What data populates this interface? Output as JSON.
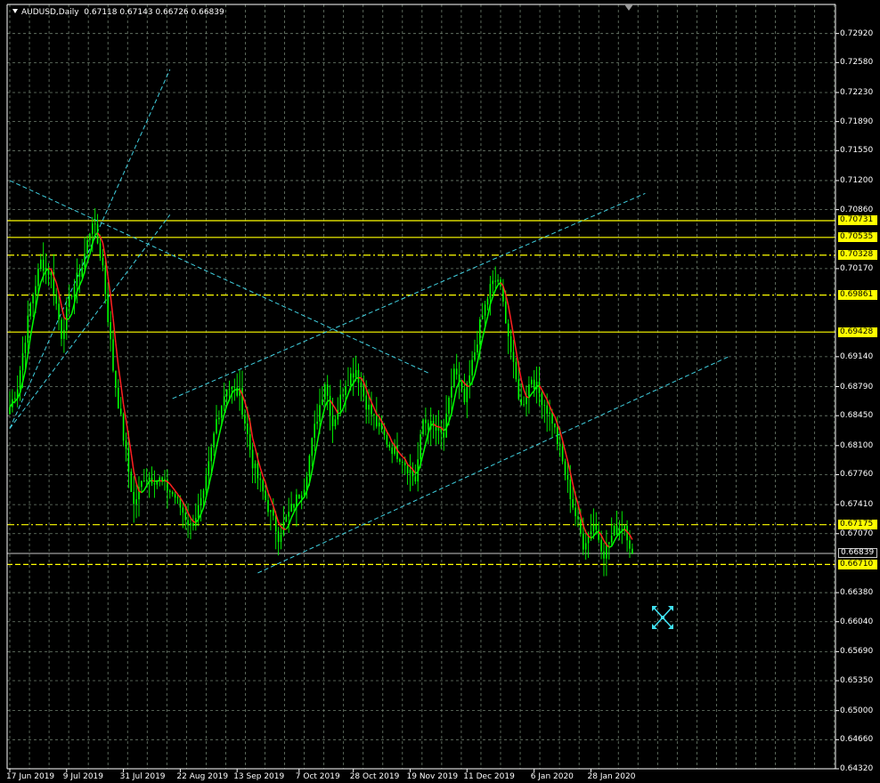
{
  "title": {
    "symbol_period": "AUDUSD,Daily",
    "ohlc": "0.67118 0.67143 0.66726 0.66839"
  },
  "colors": {
    "background": "#000000",
    "grid": "#6f7f6f",
    "bull": "#00ff00",
    "ma": "#ff2020",
    "trend": "#40d0e0",
    "level": "#ffff00",
    "price_line": "#c8c8c8",
    "text": "#ffffff"
  },
  "icons": {
    "shift_marker": "triangle-down-icon",
    "cursor": "move-cursor-icon"
  },
  "chart_data": {
    "type": "candlestick",
    "symbol": "AUDUSD",
    "timeframe": "Daily",
    "x_ticks": [
      {
        "label": "17 Jun 2019",
        "day": 0
      },
      {
        "label": "9 Jul 2019",
        "day": 22
      },
      {
        "label": "31 Jul 2019",
        "day": 44
      },
      {
        "label": "22 Aug 2019",
        "day": 66
      },
      {
        "label": "13 Sep 2019",
        "day": 88
      },
      {
        "label": "7 Oct 2019",
        "day": 112
      },
      {
        "label": "28 Oct 2019",
        "day": 133
      },
      {
        "label": "19 Nov 2019",
        "day": 155
      },
      {
        "label": "11 Dec 2019",
        "day": 177
      },
      {
        "label": "6 Jan 2020",
        "day": 203
      },
      {
        "label": "28 Jan 2020",
        "day": 225
      }
    ],
    "x_range": [
      0,
      250
    ],
    "y_ticks": [
      "0.72920",
      "0.72580",
      "0.72230",
      "0.71890",
      "0.71550",
      "0.71200",
      "0.70860",
      "0.70170",
      "0.69140",
      "0.68790",
      "0.68450",
      "0.68100",
      "0.67760",
      "0.67410",
      "0.67070",
      "0.66380",
      "0.66040",
      "0.65690",
      "0.65350",
      "0.65000",
      "0.64660",
      "0.64320"
    ],
    "ylim": [
      0.6432,
      0.7326
    ],
    "grid": true,
    "anchors": [
      {
        "day": 0,
        "price": 0.6855
      },
      {
        "day": 3,
        "price": 0.688
      },
      {
        "day": 8,
        "price": 0.6975
      },
      {
        "day": 12,
        "price": 0.7025
      },
      {
        "day": 16,
        "price": 0.701
      },
      {
        "day": 20,
        "price": 0.694
      },
      {
        "day": 24,
        "price": 0.699
      },
      {
        "day": 28,
        "price": 0.702
      },
      {
        "day": 32,
        "price": 0.7075
      },
      {
        "day": 36,
        "price": 0.702
      },
      {
        "day": 40,
        "price": 0.69
      },
      {
        "day": 44,
        "price": 0.682
      },
      {
        "day": 48,
        "price": 0.674
      },
      {
        "day": 52,
        "price": 0.6775
      },
      {
        "day": 58,
        "price": 0.677
      },
      {
        "day": 64,
        "price": 0.675
      },
      {
        "day": 70,
        "price": 0.6715
      },
      {
        "day": 75,
        "price": 0.675
      },
      {
        "day": 80,
        "price": 0.684
      },
      {
        "day": 84,
        "price": 0.688
      },
      {
        "day": 89,
        "price": 0.687
      },
      {
        "day": 94,
        "price": 0.679
      },
      {
        "day": 98,
        "price": 0.6755
      },
      {
        "day": 104,
        "price": 0.6705
      },
      {
        "day": 108,
        "price": 0.673
      },
      {
        "day": 114,
        "price": 0.6765
      },
      {
        "day": 118,
        "price": 0.683
      },
      {
        "day": 122,
        "price": 0.6885
      },
      {
        "day": 125,
        "price": 0.6835
      },
      {
        "day": 130,
        "price": 0.6885
      },
      {
        "day": 134,
        "price": 0.69
      },
      {
        "day": 138,
        "price": 0.686
      },
      {
        "day": 142,
        "price": 0.6835
      },
      {
        "day": 147,
        "price": 0.681
      },
      {
        "day": 152,
        "price": 0.6795
      },
      {
        "day": 157,
        "price": 0.677
      },
      {
        "day": 160,
        "price": 0.684
      },
      {
        "day": 164,
        "price": 0.683
      },
      {
        "day": 168,
        "price": 0.682
      },
      {
        "day": 172,
        "price": 0.69
      },
      {
        "day": 176,
        "price": 0.686
      },
      {
        "day": 182,
        "price": 0.695
      },
      {
        "day": 186,
        "price": 0.6995
      },
      {
        "day": 189,
        "price": 0.7005
      },
      {
        "day": 192,
        "price": 0.696
      },
      {
        "day": 195,
        "price": 0.69
      },
      {
        "day": 198,
        "price": 0.6855
      },
      {
        "day": 202,
        "price": 0.689
      },
      {
        "day": 206,
        "price": 0.6865
      },
      {
        "day": 210,
        "price": 0.684
      },
      {
        "day": 214,
        "price": 0.679
      },
      {
        "day": 218,
        "price": 0.674
      },
      {
        "day": 222,
        "price": 0.6695
      },
      {
        "day": 226,
        "price": 0.672
      },
      {
        "day": 230,
        "price": 0.6685
      },
      {
        "day": 234,
        "price": 0.671
      },
      {
        "day": 238,
        "price": 0.6718
      },
      {
        "day": 241,
        "price": 0.6684
      }
    ],
    "ma_period": 5,
    "levels": [
      {
        "price": 0.70731,
        "label": "0.70731",
        "style": "solid"
      },
      {
        "price": 0.70535,
        "label": "0.70535",
        "style": "solid"
      },
      {
        "price": 0.70328,
        "label": "0.70328",
        "style": "dashdot"
      },
      {
        "price": 0.69861,
        "label": "0.69861",
        "style": "dashdot"
      },
      {
        "price": 0.69428,
        "label": "0.69428",
        "style": "solid"
      },
      {
        "price": 0.67175,
        "label": "0.67175",
        "style": "dashdot"
      },
      {
        "price": 0.6671,
        "label": "0.66710",
        "style": "dashed"
      }
    ],
    "current_price": {
      "price": 0.66839,
      "label": "0.66839"
    },
    "trendlines": [
      {
        "d1": 0,
        "p1": 0.712,
        "d2": 162,
        "p2": 0.6895
      },
      {
        "d1": 63,
        "p1": 0.6865,
        "d2": 246,
        "p2": 0.7105
      },
      {
        "d1": 96,
        "p1": 0.6661,
        "d2": 279,
        "p2": 0.6915
      },
      {
        "d1": 0,
        "p1": 0.683,
        "d2": 62,
        "p2": 0.725
      },
      {
        "d1": 0,
        "p1": 0.683,
        "d2": 62,
        "p2": 0.708
      }
    ]
  }
}
